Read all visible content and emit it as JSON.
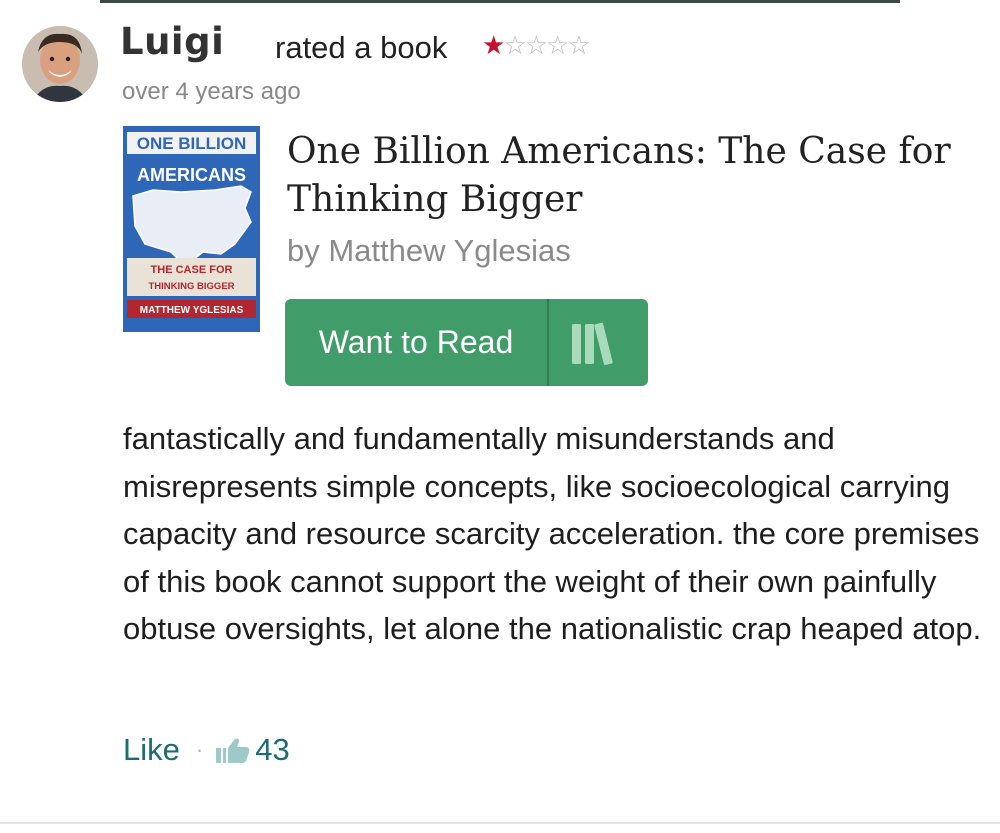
{
  "post": {
    "username": "Luigi",
    "action": "rated a book",
    "rating": 1,
    "rating_max": 5,
    "timestamp": "over 4 years ago"
  },
  "book": {
    "title": "One Billion Americans: The Case for Thinking Bigger",
    "author": "by Matthew Yglesias",
    "cover": {
      "line1": "ONE BILLION",
      "line2": "AMERICANS",
      "subtitle1": "THE CASE FOR",
      "subtitle2": "THINKING BIGGER",
      "author": "MATTHEW YGLESIAS"
    },
    "want_to_read_label": "Want to Read",
    "button_color": "#409d69"
  },
  "review": {
    "text": "fantastically and fundamentally misunderstands and misrepresents simple concepts, like socioecological carrying capacity and resource scarcity acceleration. the core premises of this book cannot support the weight of their own painfully obtuse oversights, let alone the nationalistic crap heaped atop."
  },
  "footer": {
    "like_label": "Like",
    "separator": "·",
    "like_count": "43",
    "accent_color": "#1d6b74"
  },
  "icons": {
    "avatar": "user-avatar",
    "shelf": "bookshelf-icon",
    "thumb": "thumbs-up-icon"
  }
}
